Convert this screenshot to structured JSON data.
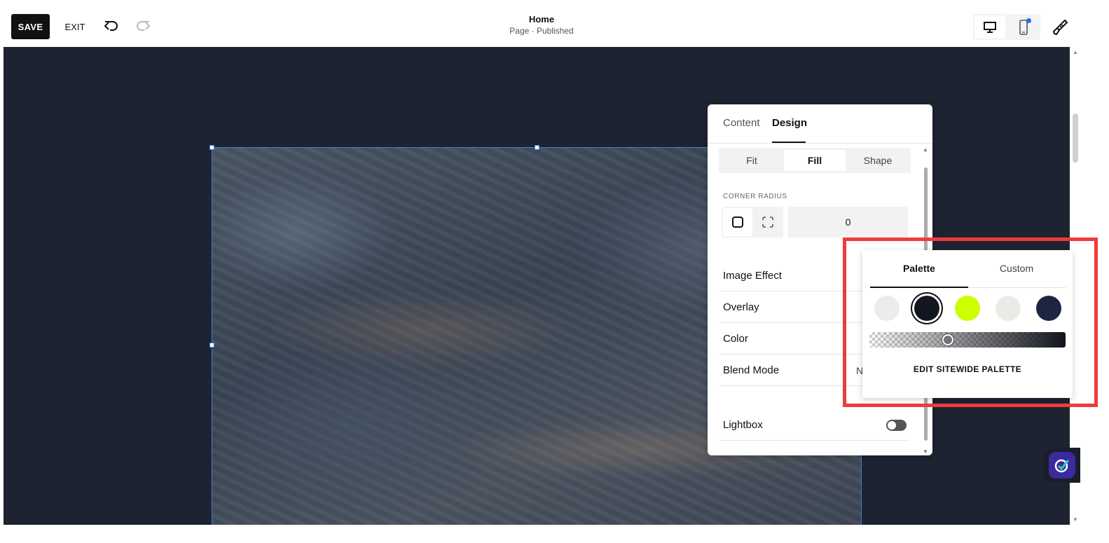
{
  "toolbar": {
    "save_label": "SAVE",
    "exit_label": "EXIT",
    "undo_icon": "undo-icon",
    "redo_icon": "redo-icon"
  },
  "header": {
    "title": "Home",
    "subtitle": "Page · Published"
  },
  "device": {
    "desktop_icon": "desktop-icon",
    "mobile_icon": "mobile-icon",
    "design_icon": "paintbrush-icon"
  },
  "panel": {
    "tabs": [
      {
        "label": "Content",
        "active": false
      },
      {
        "label": "Design",
        "active": true
      }
    ],
    "fit_modes": [
      {
        "label": "Fit",
        "active": false
      },
      {
        "label": "Fill",
        "active": true
      },
      {
        "label": "Shape",
        "active": false
      }
    ],
    "corner_radius": {
      "label": "CORNER RADIUS",
      "value": "0"
    },
    "rows": [
      {
        "label": "Image Effect",
        "value": ""
      },
      {
        "label": "Overlay",
        "value": ""
      },
      {
        "label": "Color",
        "value": ""
      },
      {
        "label": "Blend Mode",
        "value": "N"
      }
    ],
    "lightbox": {
      "label": "Lightbox",
      "enabled": false
    }
  },
  "palette": {
    "tabs": [
      {
        "label": "Palette",
        "active": true
      },
      {
        "label": "Custom",
        "active": false
      }
    ],
    "swatches": [
      {
        "color": "#ececec",
        "selected": false
      },
      {
        "color": "#11161f",
        "selected": true
      },
      {
        "color": "#ccff00",
        "selected": false
      },
      {
        "color": "#ebebe6",
        "selected": false
      },
      {
        "color": "#1e2540",
        "selected": false
      }
    ],
    "opacity": 0.4,
    "edit_label": "EDIT SITEWIDE PALETTE"
  },
  "colors": {
    "canvas_bg": "#1e2332",
    "accent": "#3f7fd6",
    "highlight": "#ef3b3b"
  }
}
